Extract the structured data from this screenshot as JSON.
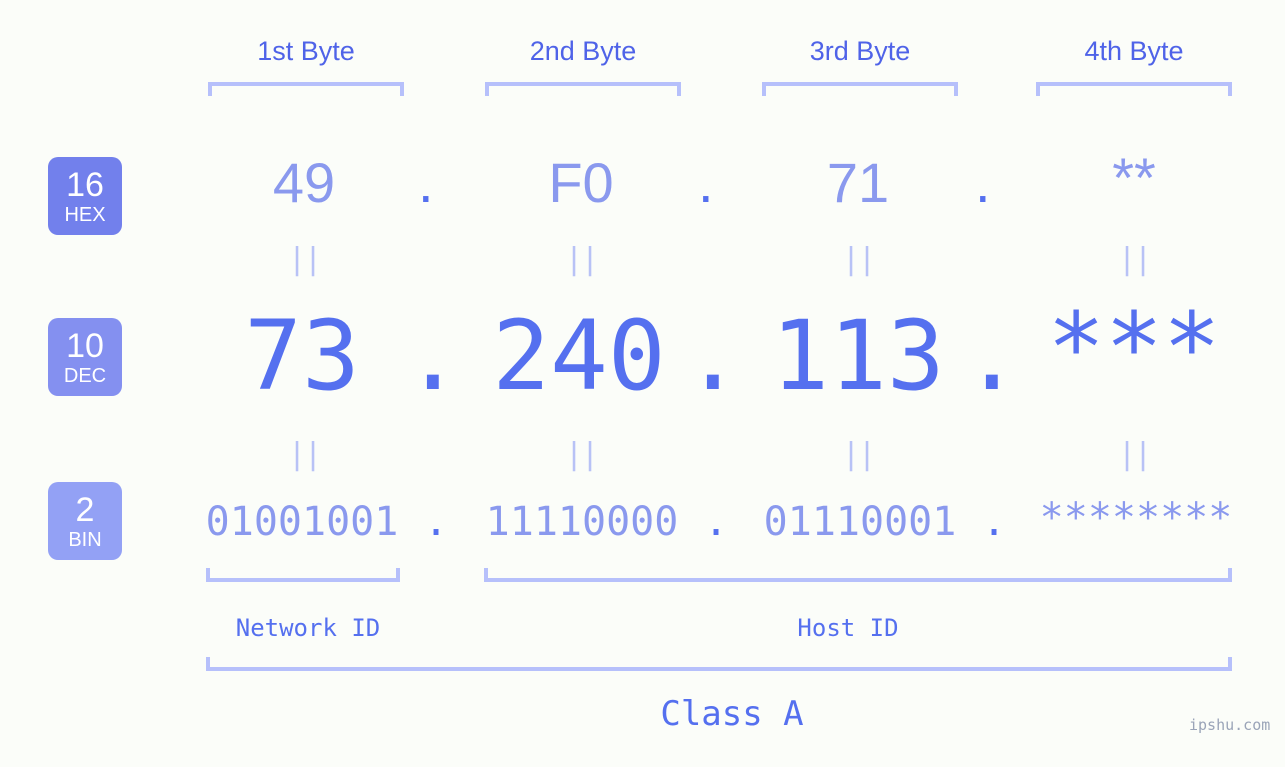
{
  "meta": {
    "watermark": "ipshu.com",
    "colors": {
      "background": "#fbfdf9",
      "accent_strong": "#5570ef",
      "accent_mid": "#8a99ee",
      "accent_light": "#b6c0fb",
      "badge_hex": "#7280ec",
      "badge_dec": "#8490f0",
      "badge_bin": "#93a1f5",
      "header_text": "#4f63e8"
    }
  },
  "byte_headers": [
    {
      "label": "1st Byte"
    },
    {
      "label": "2nd Byte"
    },
    {
      "label": "3rd Byte"
    },
    {
      "label": "4th Byte"
    }
  ],
  "bases": [
    {
      "number": "16",
      "abbr": "HEX"
    },
    {
      "number": "10",
      "abbr": "DEC"
    },
    {
      "number": "2",
      "abbr": "BIN"
    }
  ],
  "rows": {
    "hex": {
      "base_number": "16",
      "base_abbr": "HEX",
      "values": [
        "49",
        "F0",
        "71",
        "**"
      ],
      "separator": "."
    },
    "dec": {
      "base_number": "10",
      "base_abbr": "DEC",
      "values": [
        "73",
        "240",
        "113",
        "***"
      ],
      "separator": "."
    },
    "bin": {
      "base_number": "2",
      "base_abbr": "BIN",
      "values": [
        "01001001",
        "11110000",
        "01110001",
        "********"
      ],
      "separator": "."
    }
  },
  "equals_marker": "||",
  "segments": {
    "network_id": "Network ID",
    "host_id": "Host ID",
    "class": "Class A"
  }
}
